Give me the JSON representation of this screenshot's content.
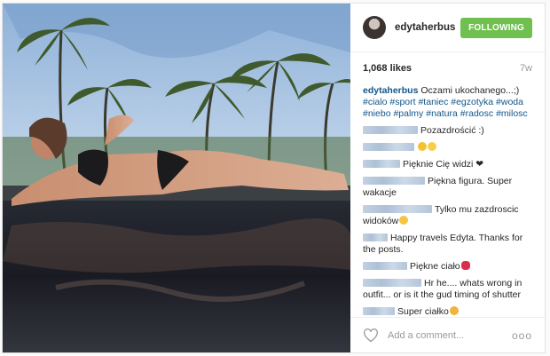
{
  "post": {
    "username": "edytaherbus",
    "follow_label": "FOLLOWING",
    "likes": "1,068 likes",
    "age": "7w",
    "caption": {
      "username": "edytaherbus",
      "text": " Oczami ukochanego...;) ",
      "tags": [
        "#cialo",
        "#sport",
        "#taniec",
        "#egzotyka",
        "#woda",
        "#niebo",
        "#palmy",
        "#natura",
        "#radosc",
        "#milosc"
      ]
    },
    "comments": [
      {
        "text": "Pozazdrościć :)",
        "emoji": []
      },
      {
        "text": "",
        "emoji": [
          "thumbs-up-emoji",
          "worried-face-emoji"
        ]
      },
      {
        "text": "Pięknie Cię widzi ❤",
        "emoji": []
      },
      {
        "text": "Piękna figura. Super wakacje",
        "emoji": []
      },
      {
        "text": "Tylko mu zazdroscic widoków",
        "emoji": [
          "scream-emoji"
        ]
      },
      {
        "text": "Happy travels Edyta. Thanks for the posts.",
        "emoji": []
      },
      {
        "text": "Piękne ciało",
        "emoji": [
          "lips-emoji"
        ]
      },
      {
        "text": "Hr he.... whats wrong in outfit... or is it the gud timing of shutter",
        "emoji": []
      },
      {
        "text": "Super ciałko",
        "emoji": [
          "ok-hand-emoji"
        ]
      }
    ],
    "add_comment_placeholder": "Add a comment...",
    "more_label": "ooo"
  },
  "colors": {
    "follow": "#70c050",
    "link": "#125688",
    "muted": "#999999"
  }
}
